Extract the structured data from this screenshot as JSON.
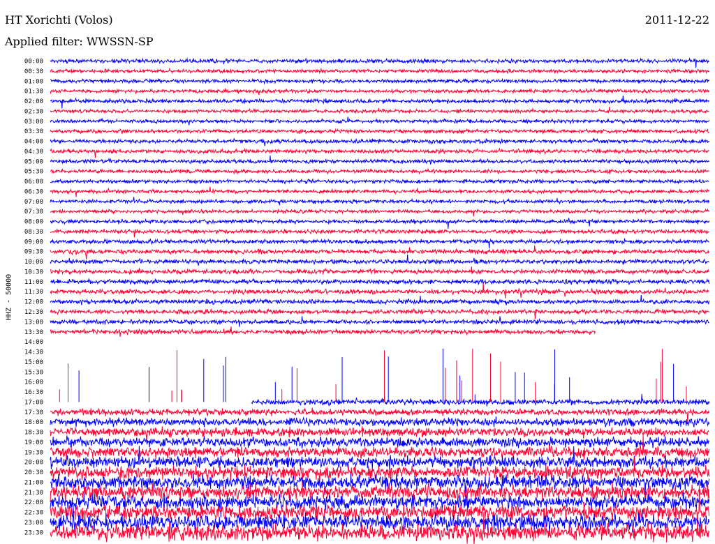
{
  "header": {
    "station": "HT Xorichti (Volos)",
    "date": "2011-12-22",
    "filter": "Applied filter: WWSSN-SP"
  },
  "chart_data": {
    "type": "line",
    "title": "HT Xorichti (Volos)",
    "ylabel": "HHZ - 50000",
    "xlabel": "",
    "series_colors": [
      "#0000ff",
      "#ff0033"
    ],
    "data_gap": [
      "13:30",
      "17:00"
    ],
    "rows": [
      {
        "label": "00:00",
        "color": "#0000ff",
        "amp": 4.5
      },
      {
        "label": "00:30",
        "color": "#ff0033",
        "amp": 4
      },
      {
        "label": "01:00",
        "color": "#0000ff",
        "amp": 4
      },
      {
        "label": "01:30",
        "color": "#ff0033",
        "amp": 4
      },
      {
        "label": "02:00",
        "color": "#0000ff",
        "amp": 4.5
      },
      {
        "label": "02:30",
        "color": "#ff0033",
        "amp": 4
      },
      {
        "label": "03:00",
        "color": "#0000ff",
        "amp": 4
      },
      {
        "label": "03:30",
        "color": "#ff0033",
        "amp": 4
      },
      {
        "label": "04:00",
        "color": "#0000ff",
        "amp": 4.5
      },
      {
        "label": "04:30",
        "color": "#ff0033",
        "amp": 4.5
      },
      {
        "label": "05:00",
        "color": "#0000ff",
        "amp": 4.5
      },
      {
        "label": "05:30",
        "color": "#ff0033",
        "amp": 4
      },
      {
        "label": "06:00",
        "color": "#0000ff",
        "amp": 4
      },
      {
        "label": "06:30",
        "color": "#ff0033",
        "amp": 4
      },
      {
        "label": "07:00",
        "color": "#0000ff",
        "amp": 4
      },
      {
        "label": "07:30",
        "color": "#ff0033",
        "amp": 4
      },
      {
        "label": "08:00",
        "color": "#0000ff",
        "amp": 4.5
      },
      {
        "label": "08:30",
        "color": "#ff0033",
        "amp": 4.5
      },
      {
        "label": "09:00",
        "color": "#0000ff",
        "amp": 4.5
      },
      {
        "label": "09:30",
        "color": "#ff0033",
        "amp": 5
      },
      {
        "label": "10:00",
        "color": "#0000ff",
        "amp": 5
      },
      {
        "label": "10:30",
        "color": "#ff0033",
        "amp": 5
      },
      {
        "label": "11:00",
        "color": "#0000ff",
        "amp": 5
      },
      {
        "label": "11:30",
        "color": "#ff0033",
        "amp": 5
      },
      {
        "label": "12:00",
        "color": "#0000ff",
        "amp": 5
      },
      {
        "label": "12:30",
        "color": "#ff0033",
        "amp": 5
      },
      {
        "label": "13:00",
        "color": "#0000ff",
        "amp": 5
      },
      {
        "label": "13:30",
        "color": "#ff0033",
        "amp": 5,
        "end_fraction": 0.827
      },
      {
        "label": "14:00",
        "color": "#0000ff",
        "amp": 0
      },
      {
        "label": "14:30",
        "color": "#ff0033",
        "amp": 0
      },
      {
        "label": "15:00",
        "color": "#0000ff",
        "amp": 0
      },
      {
        "label": "15:30",
        "color": "#ff0033",
        "amp": 0
      },
      {
        "label": "16:00",
        "color": "#0000ff",
        "amp": 0
      },
      {
        "label": "16:30",
        "color": "#ff0033",
        "amp": 0
      },
      {
        "label": "17:00",
        "color": "#0000ff",
        "amp": 6,
        "start_fraction": 0.305
      },
      {
        "label": "17:30",
        "color": "#ff0033",
        "amp": 7
      },
      {
        "label": "18:00",
        "color": "#0000ff",
        "amp": 9
      },
      {
        "label": "18:30",
        "color": "#ff0033",
        "amp": 10
      },
      {
        "label": "19:00",
        "color": "#0000ff",
        "amp": 11
      },
      {
        "label": "19:30",
        "color": "#ff0033",
        "amp": 12
      },
      {
        "label": "20:00",
        "color": "#0000ff",
        "amp": 13
      },
      {
        "label": "20:30",
        "color": "#ff0033",
        "amp": 14
      },
      {
        "label": "21:00",
        "color": "#0000ff",
        "amp": 15
      },
      {
        "label": "21:30",
        "color": "#ff0033",
        "amp": 16
      },
      {
        "label": "22:00",
        "color": "#0000ff",
        "amp": 16
      },
      {
        "label": "22:30",
        "color": "#ff0033",
        "amp": 17
      },
      {
        "label": "23:00",
        "color": "#0000ff",
        "amp": 17
      },
      {
        "label": "23:30",
        "color": "#ff0033",
        "amp": 18
      }
    ]
  }
}
